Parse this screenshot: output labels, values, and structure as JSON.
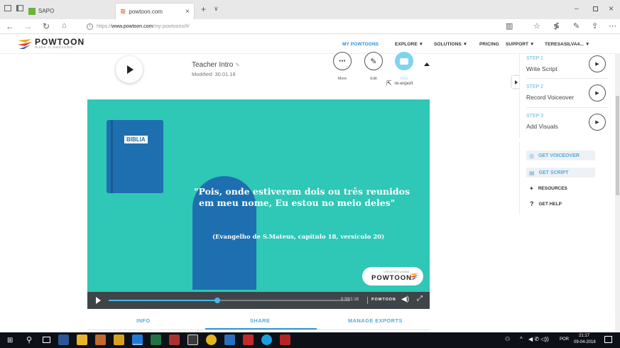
{
  "browser": {
    "tabs": [
      {
        "label": "SAPO"
      },
      {
        "label": "powtoon.com"
      }
    ],
    "new_tab_symbol": "+",
    "tab_menu_symbol": "∨",
    "url_prefix": "https://",
    "url_domain": "www.powtoon.com",
    "url_path": "/my-powtoons/#/",
    "icon_names": [
      "back-icon",
      "forward-icon",
      "refresh-icon",
      "home-icon",
      "info-icon",
      "reading-view-icon",
      "favorite-icon",
      "hub-icon",
      "notes-icon",
      "share-icon",
      "more-icon"
    ]
  },
  "header": {
    "logo_text": "POWTOON",
    "logo_tagline": "make it awesome",
    "menu": [
      "MY POWTOONS",
      "EXPLORE ▼",
      "SOLUTIONS ▼",
      "PRICING",
      "SUPPORT ▼",
      "TERESASILVA4... ▼"
    ],
    "active_color": "#2d8fd5"
  },
  "powtoon_card": {
    "title": "Teacher Intro",
    "modified": "Modified: 30.01.18",
    "actions": [
      {
        "label": "More",
        "icon": "more-icon"
      },
      {
        "label": "Edit",
        "icon": "pencil-icon"
      },
      {
        "label": "View",
        "icon": "view-icon"
      }
    ],
    "reexport_label": "re-export"
  },
  "video": {
    "book_label": "BIBLIA",
    "quote_line1": "\"Pois, onde estiverem dois ou três reunidos",
    "quote_line2": "em meu nome, Eu estou no meio deles\"",
    "citation": "(Evangelho de S.Mateus, capítulo 18, versículo 20)",
    "badge_small": "CREATED USING",
    "badge_logo": "POWTOON",
    "bg_color": "#2fc7b6",
    "book_color": "#1e6fb0",
    "progress": 0.45,
    "time": "0:39/1:18",
    "controls_logo": "POWTOON"
  },
  "bottom_tabs": [
    "INFO",
    "SHARE",
    "MANAGE EXPORTS"
  ],
  "steps": [
    {
      "step": "STEP 1",
      "title": "Write Script"
    },
    {
      "step": "STEP 2",
      "title": "Record Voiceover"
    },
    {
      "step": "STEP 3",
      "title": "Add Visuals"
    }
  ],
  "resources": [
    {
      "label": "GET VOICEOVER",
      "icon": "microphone-icon"
    },
    {
      "label": "GET SCRIPT",
      "icon": "script-icon"
    },
    {
      "label": "RESOURCES",
      "icon": "resources-icon"
    },
    {
      "label": "GET HELP",
      "icon": "help-icon"
    }
  ],
  "taskbar": {
    "lang": "POR",
    "time": "21:17",
    "date": "09-04-2018"
  }
}
